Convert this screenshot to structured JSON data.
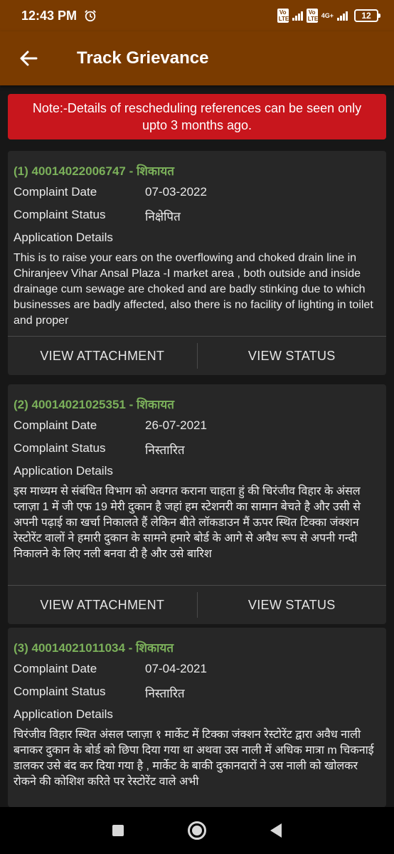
{
  "status_bar": {
    "time": "12:43 PM",
    "sim1_label": "Vo LTE",
    "sim2_label": "Vo LTE",
    "network": "4G+",
    "battery": "12"
  },
  "app_bar": {
    "title": "Track Grievance"
  },
  "note": {
    "text": "Note:-Details of rescheduling references can be seen only upto 3 months ago."
  },
  "labels": {
    "complaint_date": "Complaint Date",
    "complaint_status": "Complaint Status",
    "application_details": "Application Details",
    "view_attachment": "VIEW ATTACHMENT",
    "view_status": "VIEW STATUS"
  },
  "grievances": [
    {
      "ref": "(1) 40014022006747 - शिकायत",
      "date": "07-03-2022",
      "status": "निक्षेपित",
      "details": " This is to raise your ears on the overflowing and choked drain line in Chiranjeev Vihar Ansal Plaza -I market area , both outside and inside drainage cum sewage are choked and are badly stinking due to which businesses are badly affected, also there is no facility of lighting in toilet and proper"
    },
    {
      "ref": "(2) 40014021025351 - शिकायत",
      "date": "26-07-2021",
      "status": "निस्तारित",
      "details": "इस माध्यम से संबंधित विभाग को अवगत कराना चाहता हुं की चिरंजीव विहार के अंसल प्लाज़ा 1 में जी एफ 19 मेरी दुकान है जहां हम स्टेशनरी का सामान बेचते है और उसी से अपनी पढ़ाई का खर्चा निकालते हैं लेकिन बीते लॉकडाउन मैं ऊपर स्थित टिक्का जंक्शन रेस्टोरेंट वालों ने हमारी दुकान के सामने हमारे बोर्ड के आगे से अवैध रूप से अपनी गन्दी निकालने के लिए नली बनवा दी है और उसे बारिश"
    },
    {
      "ref": "(3) 40014021011034 - शिकायत",
      "date": "07-04-2021",
      "status": "निस्तारित",
      "details": "चिरंजीव विहार स्थित अंसल प्लाज़ा १ मार्केट में टिक्का जंक्शन रेस्टोरेंट द्वारा अवैध नाली बनाकर दुकान के बोर्ड को छिपा दिया गया था अथवा उस नाली में अधिक मात्रा m चिकनाई डालकर उसे बंद कर दिया गया है , मार्केट के बाकी दुकानदारों ने उस नाली को खोलकर रोकने की कोशिश करिते पर रेस्टोरेंट वाले अभी"
    }
  ],
  "icons": {
    "back": "arrow-left-icon",
    "alarm": "alarm-clock-icon"
  },
  "colors": {
    "app_bar": "#7a3b00",
    "note_bg": "#c8161d",
    "ref_text": "#7bb05a",
    "card_bg": "#272727",
    "page_bg": "#171717"
  }
}
